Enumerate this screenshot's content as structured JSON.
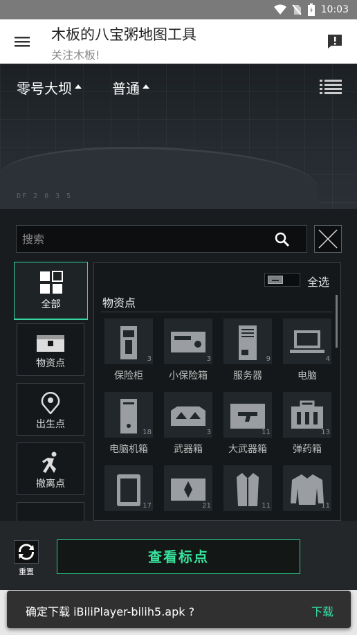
{
  "status_bar": {
    "time": "10:03"
  },
  "app_bar": {
    "title": "木板的八宝粥地图工具",
    "subtitle": "关注木板!"
  },
  "map": {
    "selector_map": "零号大坝",
    "selector_mode": "普通",
    "code_text": "DF 2 0 3 5"
  },
  "search": {
    "placeholder": "搜索"
  },
  "categories": [
    {
      "label": "全部",
      "icon": "grid-icon",
      "active": true
    },
    {
      "label": "物资点",
      "icon": "crate-icon"
    },
    {
      "label": "出生点",
      "icon": "location-target-icon"
    },
    {
      "label": "撤离点",
      "icon": "running-man-icon"
    }
  ],
  "content": {
    "select_all": "全选",
    "section_title": "物资点",
    "items": [
      {
        "label": "保险柜",
        "count": "3",
        "icon": "safe-icon"
      },
      {
        "label": "小保险箱",
        "count": "3",
        "icon": "small-safe-icon"
      },
      {
        "label": "服务器",
        "count": "9",
        "icon": "server-icon"
      },
      {
        "label": "电脑",
        "count": "4",
        "icon": "laptop-icon"
      },
      {
        "label": "电脑机箱",
        "count": "18",
        "icon": "pc-case-icon"
      },
      {
        "label": "武器箱",
        "count": "3",
        "icon": "weapon-box-icon"
      },
      {
        "label": "大武器箱",
        "count": "11",
        "icon": "large-weapon-box-icon"
      },
      {
        "label": "弹药箱",
        "count": "13",
        "icon": "ammo-box-icon"
      },
      {
        "label": "",
        "count": "17",
        "icon": "luggage-icon"
      },
      {
        "label": "",
        "count": "21",
        "icon": "supply-crate-icon"
      },
      {
        "label": "",
        "count": "11",
        "icon": "coat-icon"
      },
      {
        "label": "",
        "count": "11",
        "icon": "jacket-icon"
      }
    ]
  },
  "bottom": {
    "reset_label": "重置",
    "view_label": "查看标点"
  },
  "snackbar": {
    "message": "确定下载 iBiliPlayer-bilih5.apk ?",
    "action": "下载"
  },
  "colors": {
    "accent": "#36e29c",
    "panel": "#191c1f",
    "app_bar": "#ffffff",
    "status_bar": "#7a7a7a"
  }
}
